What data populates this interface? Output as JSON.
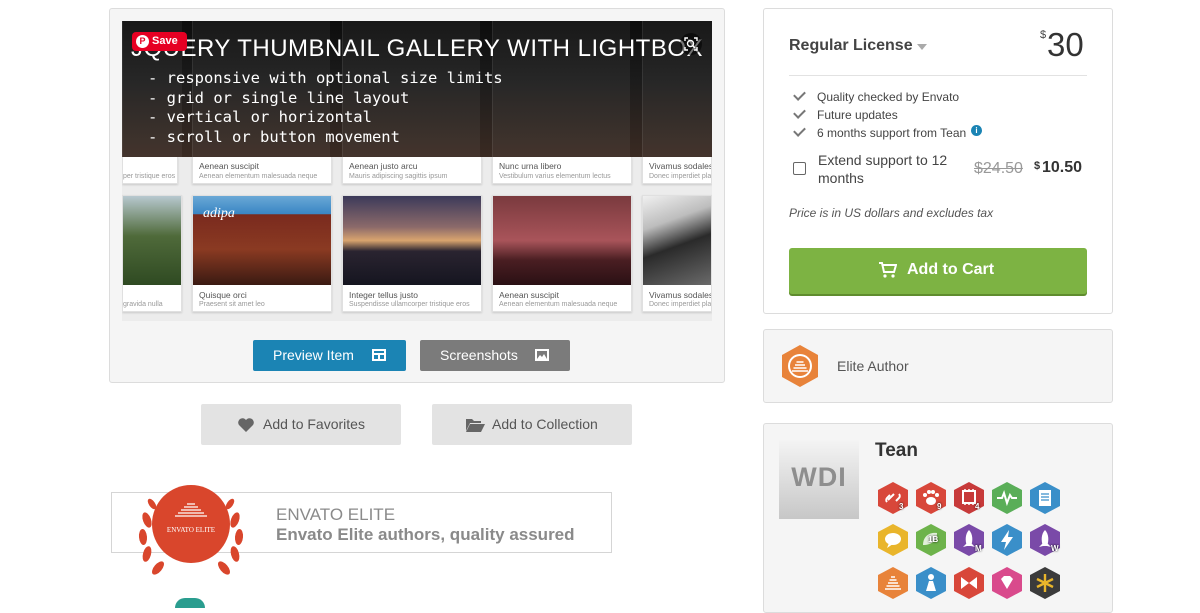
{
  "preview": {
    "banner_title": "JQUERY THUMBNAIL GALLERY WITH LIGHTBOX",
    "features": [
      "- responsive with optional size limits",
      "- grid or single line layout",
      "- vertical or horizontal",
      "- scroll or button movement"
    ],
    "pin_label": "Save",
    "top_captions": [
      {
        "title": "",
        "sub": "per tristique eros"
      },
      {
        "title": "Aenean suscipit",
        "sub": "Aenean elementum malesuada neque"
      },
      {
        "title": "Aenean justo arcu",
        "sub": "Mauris adipiscing sagittis ipsum"
      },
      {
        "title": "Nunc urna libero",
        "sub": "Vestibulum varius elementum lectus"
      },
      {
        "title": "Vivamus sodales",
        "sub": "Donec imperdiet pla"
      }
    ],
    "thumbs": [
      {
        "title": "",
        "sub": "gravida nulla"
      },
      {
        "title": "Quisque orci",
        "sub": "Praesent sit amet leo"
      },
      {
        "title": "Integer tellus justo",
        "sub": "Suspendisse ullamcorper tristique eros"
      },
      {
        "title": "Aenean suscipit",
        "sub": "Aenean elementum malesuada neque"
      },
      {
        "title": "Vivamus sodales",
        "sub": "Donec imperdiet pla"
      }
    ],
    "restaurant_sign": "adipa",
    "preview_button": "Preview Item",
    "screenshots_button": "Screenshots"
  },
  "actions": {
    "favorites": "Add to Favorites",
    "collection": "Add to Collection"
  },
  "elite_banner": {
    "medal_text": "ENVATO ELITE",
    "title": "ENVATO ELITE",
    "subtitle": "Envato Elite authors, quality assured"
  },
  "license": {
    "title": "Regular License",
    "currency": "$",
    "price": "30",
    "checks": [
      "Quality checked by Envato",
      "Future updates",
      "6 months support from Tean"
    ],
    "info_icon": "i",
    "extend_label": "Extend support to 12 months",
    "extend_old_price": "$24.50",
    "extend_currency": "$",
    "extend_new_price": "10.50",
    "note": "Price is in US dollars and excludes tax",
    "add_to_cart": "Add to Cart"
  },
  "elite_author": {
    "label": "Elite Author"
  },
  "author": {
    "avatar_text": "WDI",
    "name": "Tean",
    "badge_subs": [
      "3",
      "9",
      "4",
      "",
      "",
      "",
      "1B",
      "M",
      "",
      "W",
      "",
      "",
      "",
      "",
      ""
    ]
  },
  "colors": {
    "preview_button": "#1b84b4",
    "screenshots_button": "#7b7b7b",
    "add_to_cart": "#7db343",
    "elite_red": "#d9462c",
    "pinterest": "#e60023"
  }
}
